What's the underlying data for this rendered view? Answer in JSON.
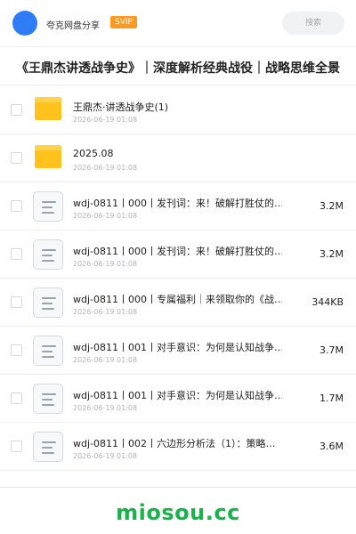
{
  "header": {
    "username": "夸克网盘分享",
    "badge": "SVIP",
    "search_placeholder": "搜索"
  },
  "title": "《王鼎杰讲透战争史》｜深度解析经典战役｜战略思维全景",
  "files": [
    {
      "type": "folder",
      "name": "王鼎杰·讲透战争史(1)",
      "date": "2026-06-19 01:08",
      "size": ""
    },
    {
      "type": "folder",
      "name": "2025.08",
      "date": "2026-06-19 01:08",
      "size": ""
    },
    {
      "type": "doc",
      "name": "wdj-0811丨000丨发刊词：来！破解打胜仗的…",
      "date": "2026-06-19 01:08",
      "size": "3.2M"
    },
    {
      "type": "doc",
      "name": "wdj-0811丨000丨发刊词：来！破解打胜仗的…",
      "date": "2026-06-19 01:08",
      "size": "3.2M"
    },
    {
      "type": "doc",
      "name": "wdj-0811丨000丨专属福利｜来领取你的《战…",
      "date": "2026-06-19 01:08",
      "size": "344KB"
    },
    {
      "type": "doc",
      "name": "wdj-0811丨001丨对手意识：为何是认知战争…",
      "date": "2026-06-19 01:08",
      "size": "3.7M"
    },
    {
      "type": "doc",
      "name": "wdj-0811丨001丨对手意识：为何是认知战争…",
      "date": "2026-06-19 01:08",
      "size": "1.7M"
    },
    {
      "type": "doc",
      "name": "wdj-0811丨002丨六边形分析法（1）：策略…",
      "date": "2026-06-19 01:08",
      "size": "3.6M"
    }
  ],
  "watermark": "miosou.cc",
  "colors": {
    "accent": "#2f7df6",
    "badge": "#ff9a1f",
    "folder": "#ffc21d",
    "watermark": "#18b34a"
  }
}
